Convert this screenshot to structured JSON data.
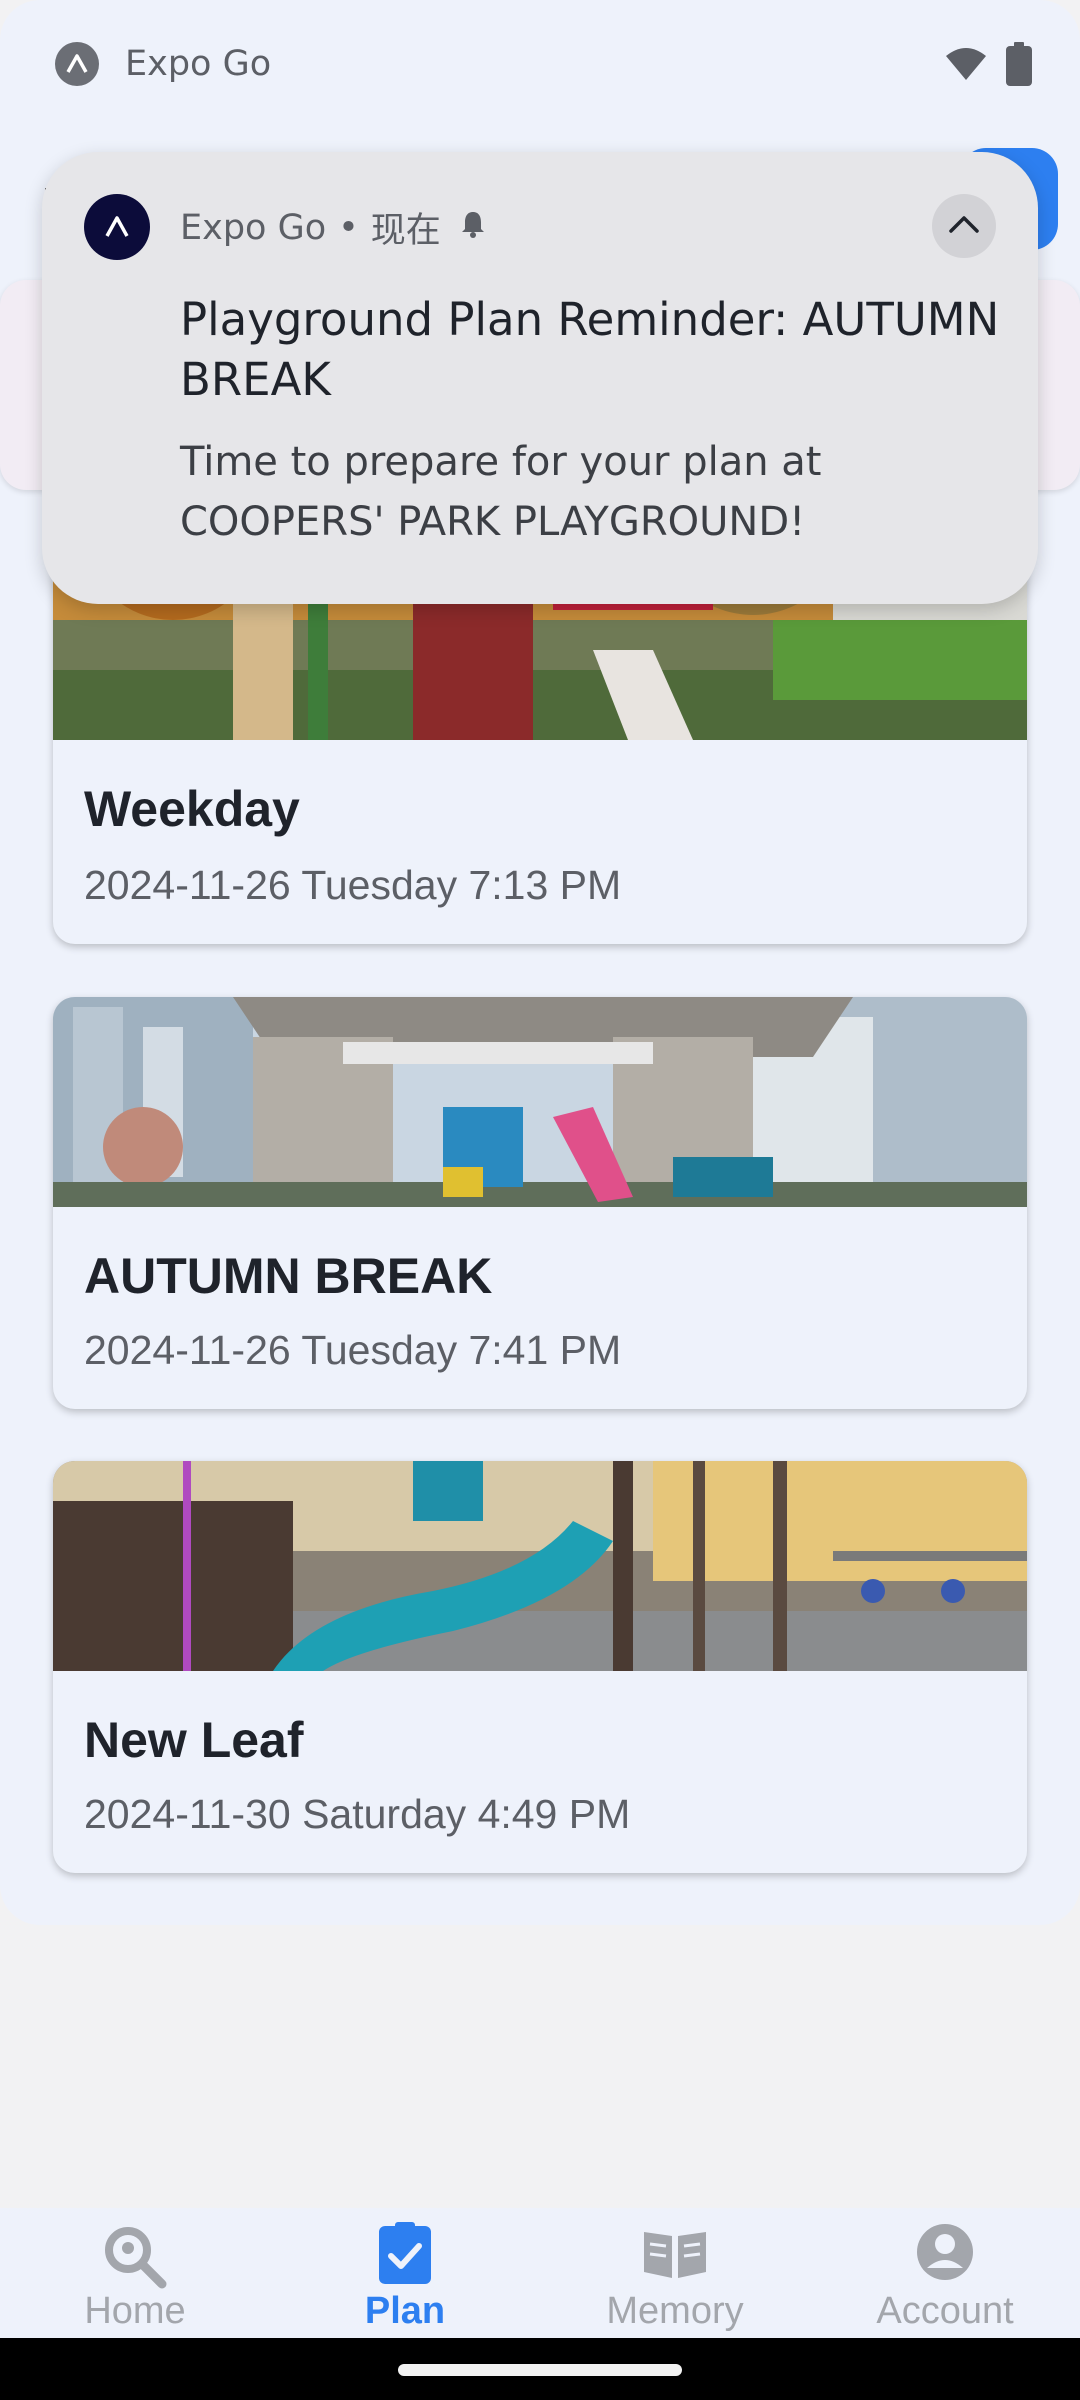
{
  "status_bar": {
    "app_name": "Expo Go",
    "icons": [
      "expo-icon",
      "wifi-icon",
      "battery-icon"
    ]
  },
  "notification": {
    "app_name": "Expo Go",
    "separator": "•",
    "time": "现在",
    "title": "Playground Plan Reminder: AUTUMN BREAK",
    "body": "Time to prepare for your plan at COOPERS' PARK PLAYGROUND!",
    "icons": [
      "expo-icon",
      "bell-icon",
      "chevron-up-icon"
    ]
  },
  "plans": [
    {
      "title": "Weekday",
      "date": "2024-11-26 Tuesday 7:13 PM"
    },
    {
      "title": "AUTUMN BREAK",
      "date": "2024-11-26 Tuesday 7:41 PM"
    },
    {
      "title": "New Leaf",
      "date": "2024-11-30 Saturday 4:49 PM"
    }
  ],
  "bottom_nav": {
    "items": [
      {
        "label": "Home",
        "icon": "search-location-icon",
        "active": false
      },
      {
        "label": "Plan",
        "icon": "clipboard-check-icon",
        "active": true
      },
      {
        "label": "Memory",
        "icon": "open-book-icon",
        "active": false
      },
      {
        "label": "Account",
        "icon": "account-circle-icon",
        "active": false
      }
    ]
  },
  "colors": {
    "accent": "#2d7ff0",
    "inactive": "#a3a6ac",
    "card_background": "#eef2fb",
    "notification_background": "#e6e6e9"
  }
}
